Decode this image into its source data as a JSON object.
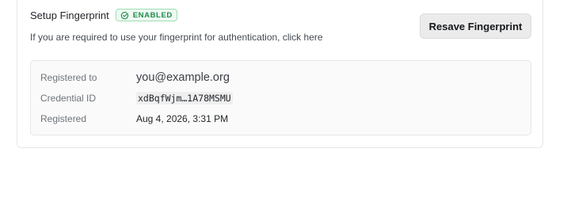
{
  "fingerprint": {
    "title": "Setup Fingerprint",
    "status_badge": "ENABLED",
    "status_color": "#1f8a4c",
    "status_icon": "check-circle-icon",
    "description": "If you are required to use your fingerprint for authentication, click here",
    "resave_label": "Resave Fingerprint"
  },
  "details": [
    {
      "label": "Registered to",
      "value": "you@example.org"
    },
    {
      "label": "Credential ID",
      "value": "xdBqfWjm…1A78MSMU"
    },
    {
      "label": "Registered",
      "value": "Aug 4, 2026, 3:31 PM"
    }
  ]
}
